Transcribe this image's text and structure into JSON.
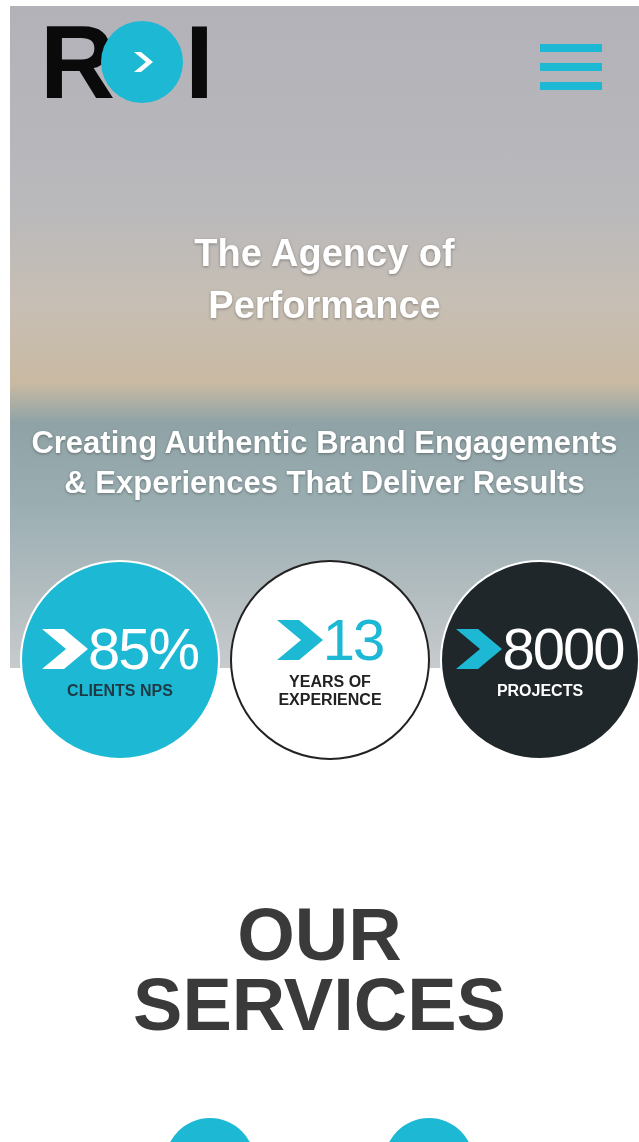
{
  "header": {
    "logo": {
      "left": "R",
      "right": "I"
    }
  },
  "hero": {
    "title": "The Agency of Performance",
    "subtitle": "Creating Authentic Brand Engagements & Experiences That Deliver Results"
  },
  "stats": [
    {
      "kind": "cyan",
      "value": "85%",
      "label": "CLIENTS NPS"
    },
    {
      "kind": "white",
      "value": "13",
      "label": "YEARS OF EXPERIENCE"
    },
    {
      "kind": "dark",
      "value": "8000",
      "label": "PROJECTS"
    }
  ],
  "services": {
    "heading": "OUR SERVICES"
  }
}
